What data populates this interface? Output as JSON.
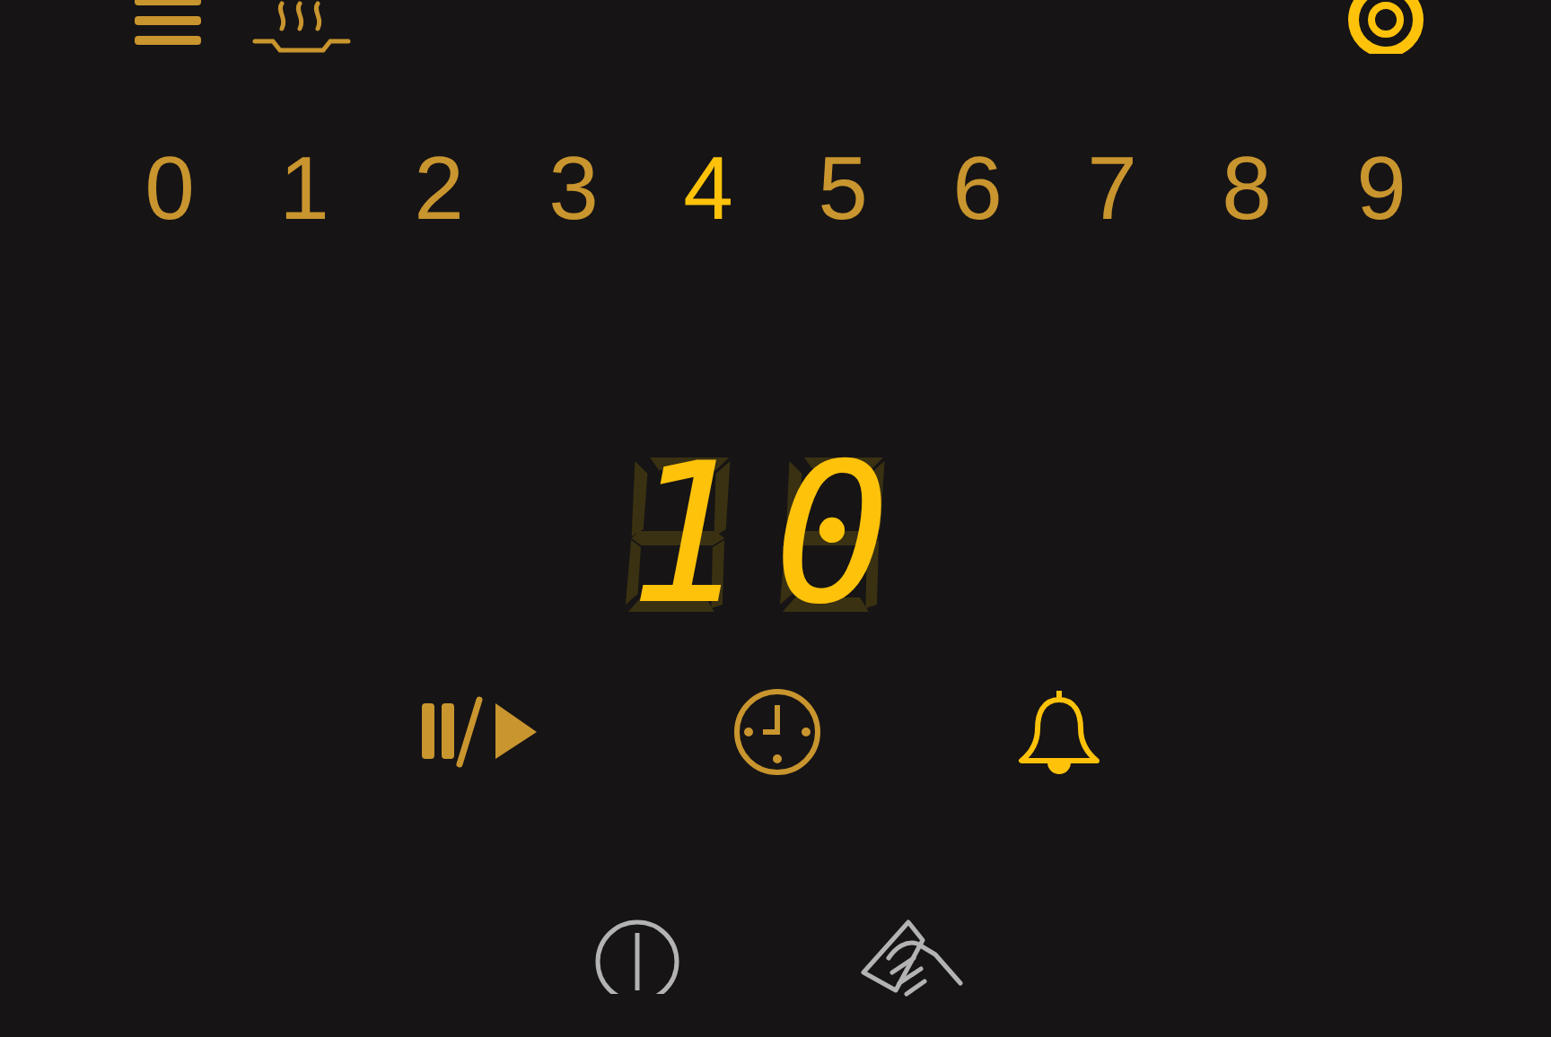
{
  "top_icons": [
    {
      "kind": "menu",
      "active": false
    },
    {
      "kind": "steam",
      "active": false
    },
    {
      "kind": "ring",
      "active": true
    }
  ],
  "levels": [
    {
      "label": "0",
      "selected": false
    },
    {
      "label": "1",
      "selected": false
    },
    {
      "label": "2",
      "selected": false
    },
    {
      "label": "3",
      "selected": false
    },
    {
      "label": "4",
      "selected": true
    },
    {
      "label": "5",
      "selected": false
    },
    {
      "label": "6",
      "selected": false
    },
    {
      "label": "7",
      "selected": false
    },
    {
      "label": "8",
      "selected": false
    },
    {
      "label": "9",
      "selected": false
    }
  ],
  "display": "10",
  "controls": [
    {
      "kind": "pause-play",
      "active": false
    },
    {
      "kind": "clock",
      "active": false
    },
    {
      "kind": "bell",
      "active": true
    }
  ],
  "bottom_icons": [
    {
      "kind": "power"
    },
    {
      "kind": "wipe"
    }
  ]
}
